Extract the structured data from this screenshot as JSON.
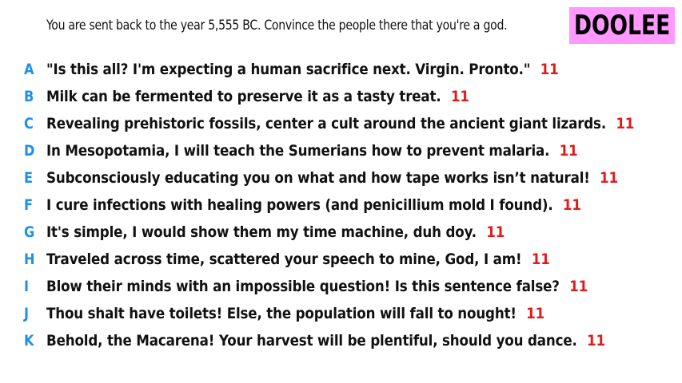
{
  "prompt": "You are sent back to the year 5,555 BC. Convince the people there that you're a god.",
  "brand": "DOOLEE",
  "colors": {
    "letter": "#1e90e8",
    "score": "#e31a1a",
    "brand_bg": "#ff99ff",
    "text": "#111111"
  },
  "answers": [
    {
      "letter": "A",
      "text": "\"Is this all? I'm expecting a human sacrifice next. Virgin. Pronto.\"",
      "score": "11"
    },
    {
      "letter": "B",
      "text": "Milk can be fermented to preserve it as a tasty treat.",
      "score": "11"
    },
    {
      "letter": "C",
      "text": "Revealing prehistoric fossils, center a cult around the ancient giant lizards.",
      "score": "11"
    },
    {
      "letter": "D",
      "text": "In Mesopotamia, I will teach the Sumerians how to prevent malaria.",
      "score": "11"
    },
    {
      "letter": "E",
      "text": "Subconsciously educating you on what and how tape works isn’t natural!",
      "score": "11"
    },
    {
      "letter": "F",
      "text": "I cure infections with healing powers (and penicillium mold I found).",
      "score": "11"
    },
    {
      "letter": "G",
      "text": "It's simple, I would show them my time machine, duh doy.",
      "score": "11"
    },
    {
      "letter": "H",
      "text": "Traveled across time, scattered your speech to mine, God, I am!",
      "score": "11"
    },
    {
      "letter": "I",
      "text": "Blow their minds with an impossible question! Is this sentence false?",
      "score": "11"
    },
    {
      "letter": "J",
      "text": "Thou shalt have toilets! Else, the population will fall to nought!",
      "score": "11"
    },
    {
      "letter": "K",
      "text": "Behold, the Macarena! Your harvest will be plentiful, should you dance.",
      "score": "11"
    }
  ]
}
